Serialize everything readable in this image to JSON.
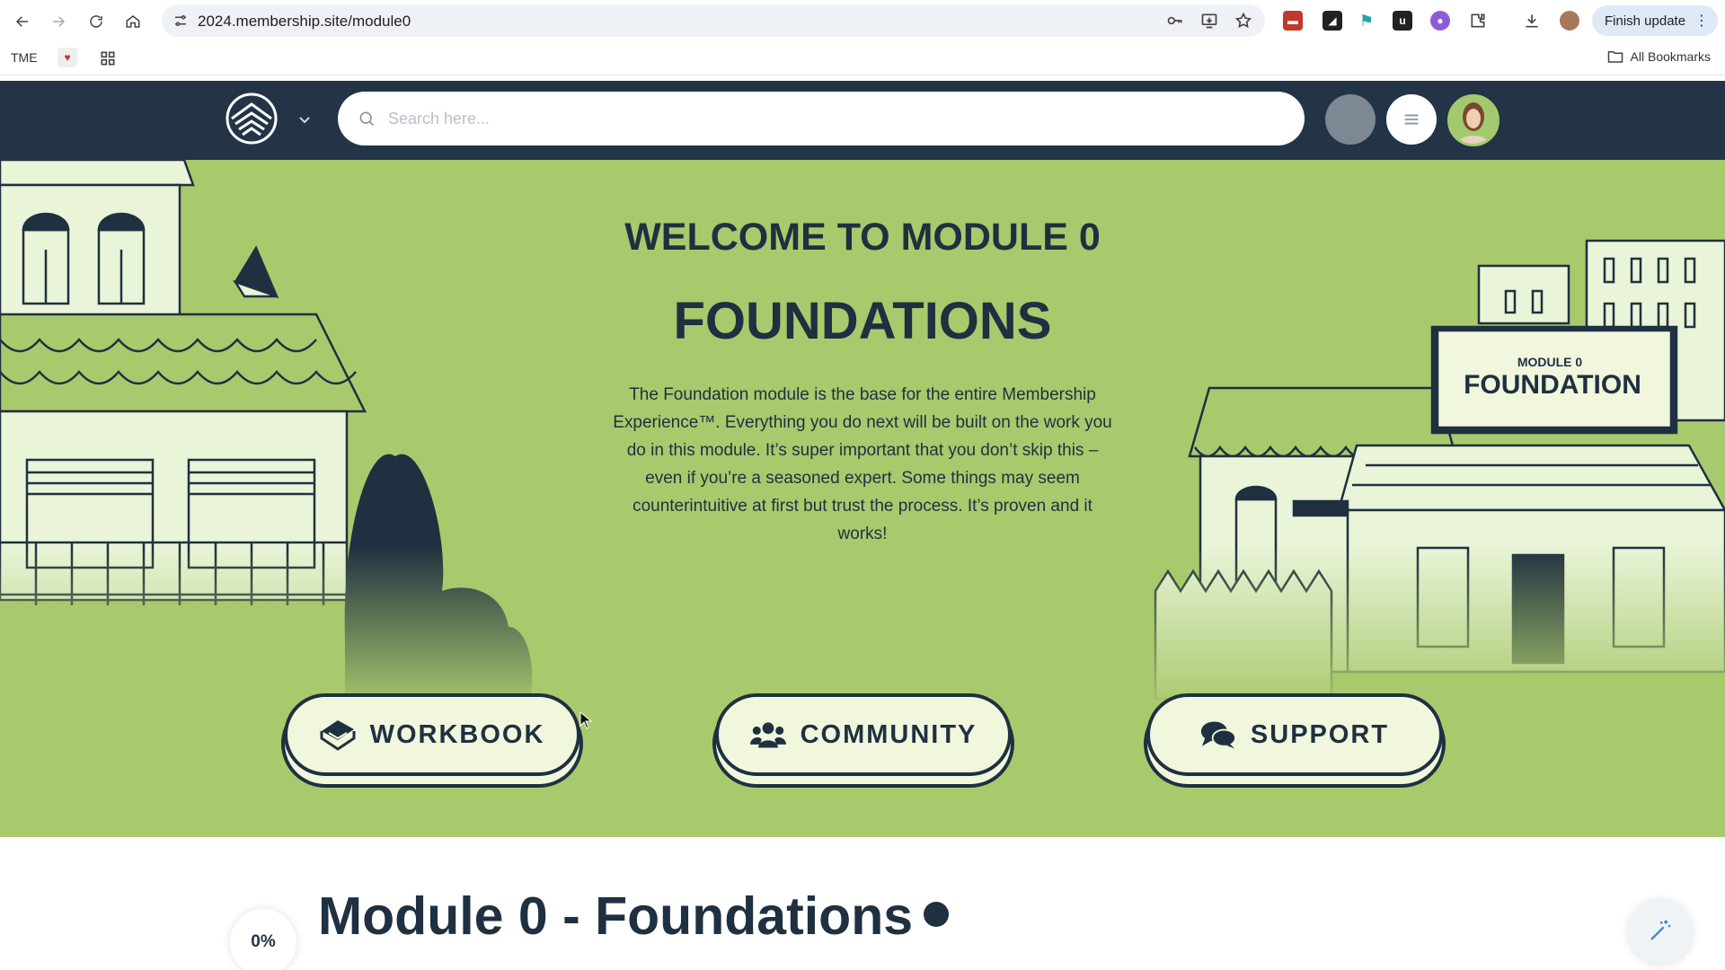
{
  "browser": {
    "url": "2024.membership.site/module0",
    "finish_update_label": "Finish update",
    "bookmarks": {
      "tme_label": "TME",
      "all_bookmarks_label": "All Bookmarks"
    }
  },
  "header": {
    "search_placeholder": "Search here..."
  },
  "hero": {
    "welcome_title": "WELCOME TO MODULE 0",
    "main_title": "FOUNDATIONS",
    "description": "The Foundation module is the base for the entire Membership Experience™. Everything you do next will be built on the work you do in this module. It’s super important that you don’t skip this – even if you’re a seasoned expert. Some things may seem counterintuitive at first but trust the process. It’s proven and it works!",
    "sign": {
      "line1": "MODULE 0",
      "line2": "FOUNDATION"
    },
    "buttons": [
      {
        "label": "WORKBOOK",
        "icon": "book-icon"
      },
      {
        "label": "COMMUNITY",
        "icon": "users-icon"
      },
      {
        "label": "SUPPORT",
        "icon": "comments-icon"
      }
    ]
  },
  "module": {
    "progress_label": "0%",
    "progress_value": 0,
    "title": "Module 0 - Foundations"
  },
  "colors": {
    "hero_green": "#a9c96d",
    "navy": "#1f3040",
    "header_navy": "#233446",
    "button_fill": "#f0f7dd"
  }
}
